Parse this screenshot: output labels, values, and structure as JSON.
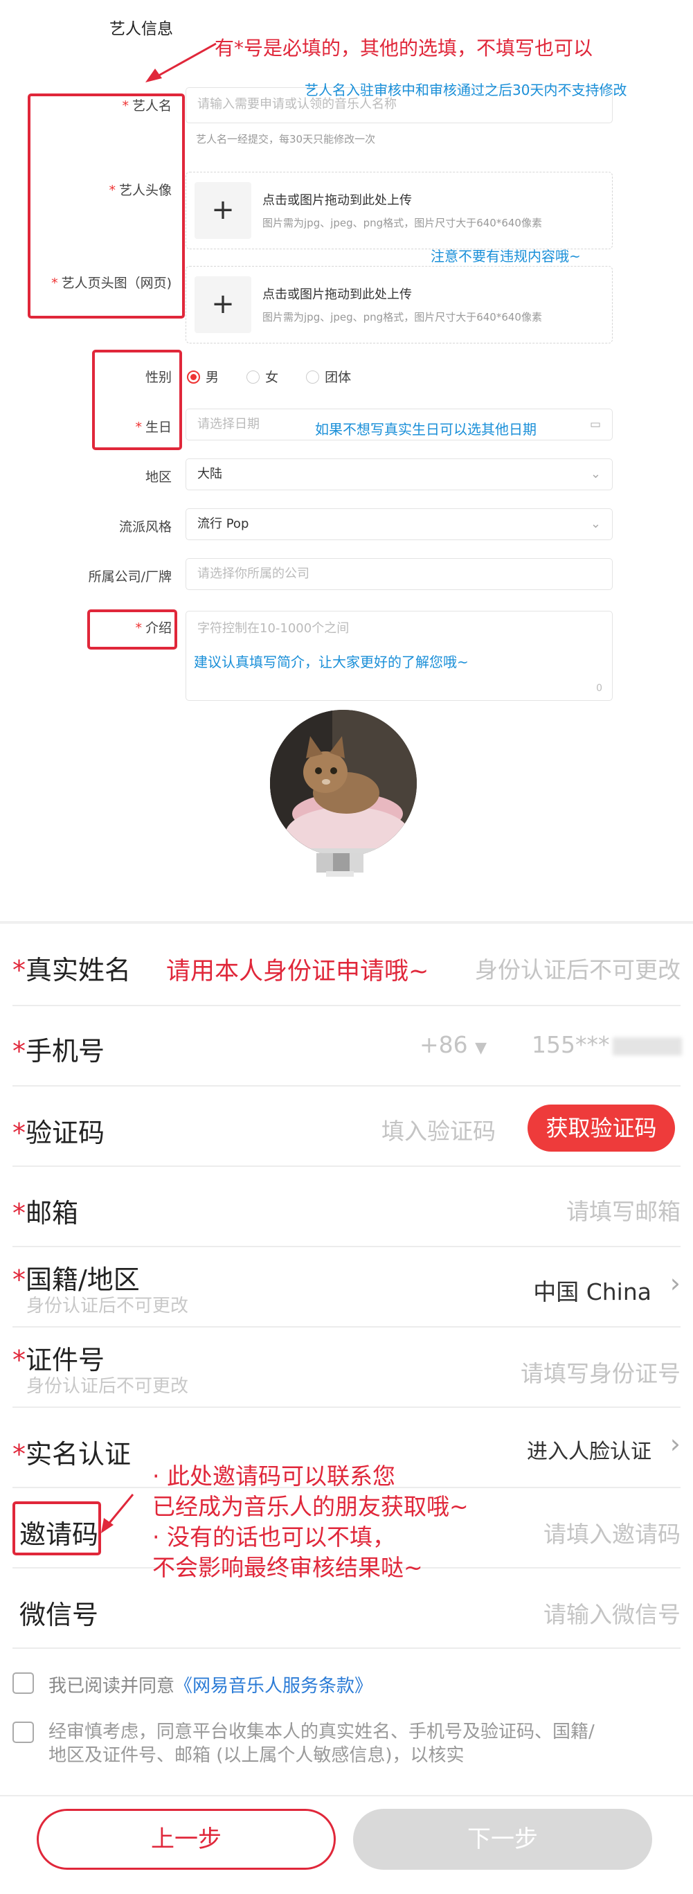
{
  "section_title": "艺人信息",
  "form": {
    "artist_name": {
      "label": "艺人名",
      "placeholder": "请输入需要申请或认领的音乐人名称",
      "hint": "艺人名一经提交，每30天只能修改一次"
    },
    "avatar": {
      "label": "艺人头像",
      "upload_text": "点击或图片拖动到此处上传",
      "upload_hint": "图片需为jpg、jpeg、png格式，图片尺寸大于640*640像素"
    },
    "header_image": {
      "label": "艺人页头图（网页)",
      "upload_text": "点击或图片拖动到此处上传",
      "upload_hint": "图片需为jpg、jpeg、png格式，图片尺寸大于640*640像素"
    },
    "gender": {
      "label": "性别",
      "options": [
        "男",
        "女",
        "团体"
      ],
      "selected": "男"
    },
    "birthday": {
      "label": "生日",
      "placeholder": "请选择日期"
    },
    "region": {
      "label": "地区",
      "value": "大陆"
    },
    "genre": {
      "label": "流派风格",
      "value": "流行 Pop"
    },
    "company": {
      "label": "所属公司/厂牌",
      "placeholder": "请选择你所属的公司"
    },
    "intro": {
      "label": "介绍",
      "placeholder": "字符控制在10-1000个之间",
      "count": "0"
    }
  },
  "mobile": {
    "real_name": {
      "label": "真实姓名",
      "placeholder": "身份认证后不可更改"
    },
    "phone": {
      "label": "手机号",
      "country_code": "+86",
      "value": "155***"
    },
    "code": {
      "label": "验证码",
      "placeholder": "填入验证码",
      "button": "获取验证码"
    },
    "email": {
      "label": "邮箱",
      "placeholder": "请填写邮箱"
    },
    "nationality": {
      "label": "国籍/地区",
      "sub": "身份认证后不可更改",
      "value": "中国 China"
    },
    "id_number": {
      "label": "证件号",
      "sub": "身份认证后不可更改",
      "placeholder": "请填写身份证号"
    },
    "verification": {
      "label": "实名认证",
      "value": "进入人脸认证"
    },
    "invite_code": {
      "label": "邀请码",
      "placeholder": "请填入邀请码"
    },
    "wechat": {
      "label": "微信号",
      "placeholder": "请输入微信号"
    },
    "agree_prefix": "我已阅读并同意",
    "agree_link": "《网易音乐人服务条款》",
    "consent_text": "经审慎考虑，同意平台收集本人的真实姓名、手机号及验证码、国籍/地区及证件号、邮箱 (以上属个人敏感信息)，以核实",
    "prev_button": "上一步",
    "next_button": "下一步"
  },
  "annotations": {
    "required_note": "有*号是必填的，其他的选填，不填写也可以",
    "name_note": "艺人名入驻审核中和审核通过之后30天内不支持修改",
    "no_violation": "注意不要有违规内容哦~",
    "birthday_note": "如果不想写真实生日可以选其他日期",
    "intro_note": "建议认真填写简介，让大家更好的了解您哦~",
    "real_name_note": "请用本人身份证申请哦~",
    "invite_note_1": "· 此处邀请码可以联系您",
    "invite_note_2": "已经成为音乐人的朋友获取哦~",
    "invite_note_3": "· 没有的话也可以不填，",
    "invite_note_4": "不会影响最终审核结果哒~"
  },
  "colors": {
    "accent": "#e0273a",
    "annotation_blue": "#1a8fd8",
    "link": "#2b7bd6"
  }
}
